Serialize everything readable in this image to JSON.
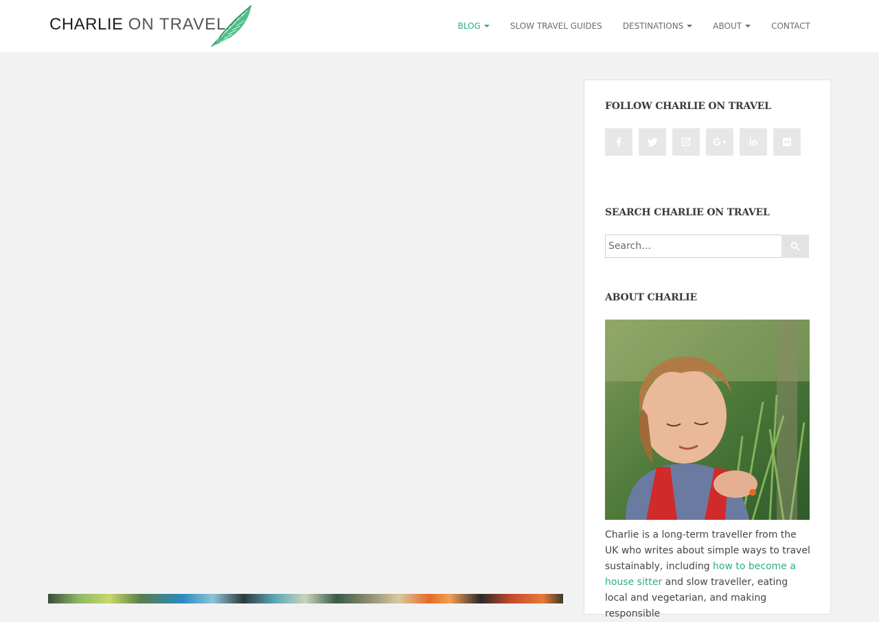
{
  "site": {
    "logo_word1": "CHARLIE",
    "logo_word2": "ON TRAVEL",
    "accent_color": "#2baf7b"
  },
  "nav": {
    "items": [
      {
        "label": "BLOG",
        "has_caret": true,
        "active": true
      },
      {
        "label": "SLOW TRAVEL GUIDES",
        "has_caret": false,
        "active": false
      },
      {
        "label": "DESTINATIONS",
        "has_caret": true,
        "active": false
      },
      {
        "label": "ABOUT",
        "has_caret": true,
        "active": false
      },
      {
        "label": "CONTACT",
        "has_caret": false,
        "active": false
      }
    ]
  },
  "sidebar": {
    "follow_title": "FOLLOW CHARLIE ON TRAVEL",
    "social_icons": [
      "facebook-icon",
      "twitter-icon",
      "instagram-icon",
      "google-plus-icon",
      "linkedin-icon",
      "flickr-icon"
    ],
    "search_title": "SEARCH CHARLIE ON TRAVEL",
    "search_placeholder": "Search…",
    "search_icon": "search-icon",
    "about_title": "ABOUT CHARLIE",
    "about_text_1": "Charlie is a long-term traveller from the UK who writes about simple ways to travel sustainably, including ",
    "about_link": "how to become a house sitter",
    "about_text_2": " and slow traveller, eating local and vegetarian, and making responsible"
  }
}
